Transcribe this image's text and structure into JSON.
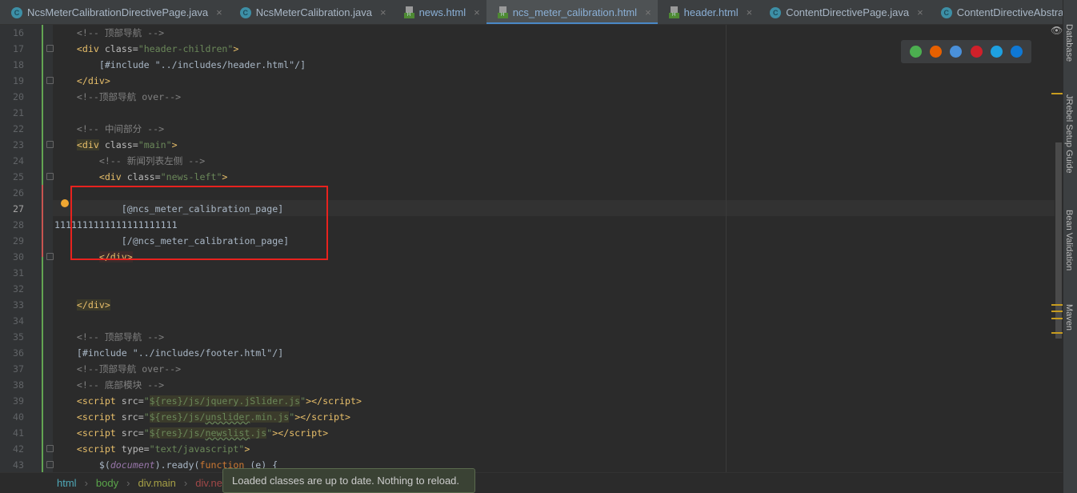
{
  "tabs": [
    {
      "label": "NcsMeterCalibrationDirectivePage.java",
      "type": "java",
      "active": false
    },
    {
      "label": "NcsMeterCalibration.java",
      "type": "java",
      "active": false
    },
    {
      "label": "news.html",
      "type": "html",
      "active": false
    },
    {
      "label": "ncs_meter_calibration.html",
      "type": "html",
      "active": true
    },
    {
      "label": "header.html",
      "type": "html",
      "active": false
    },
    {
      "label": "ContentDirectivePage.java",
      "type": "java",
      "active": false
    },
    {
      "label": "ContentDirectiveAbstract.java",
      "type": "java",
      "active": false
    }
  ],
  "editor": {
    "current_line": 27,
    "lines": [
      {
        "n": 16,
        "tokens": [
          [
            "    ",
            ""
          ],
          [
            "<!-- 顶部导航 -->",
            "c"
          ]
        ]
      },
      {
        "n": 17,
        "tokens": [
          [
            "    ",
            ""
          ],
          [
            "<div ",
            "t"
          ],
          [
            "class=",
            "a"
          ],
          [
            "\"header-children\"",
            "s"
          ],
          [
            ">",
            "t"
          ]
        ]
      },
      {
        "n": 18,
        "tokens": [
          [
            "        ",
            ""
          ],
          [
            "[#include \"../includes/header.html\"/]",
            "p"
          ]
        ]
      },
      {
        "n": 19,
        "tokens": [
          [
            "    ",
            ""
          ],
          [
            "</div>",
            "t"
          ]
        ]
      },
      {
        "n": 20,
        "tokens": [
          [
            "    ",
            ""
          ],
          [
            "<!--顶部导航 over-->",
            "c"
          ]
        ]
      },
      {
        "n": 21,
        "tokens": []
      },
      {
        "n": 22,
        "tokens": [
          [
            "    ",
            ""
          ],
          [
            "<!-- 中间部分 -->",
            "c"
          ]
        ]
      },
      {
        "n": 23,
        "tokens": [
          [
            "    ",
            ""
          ],
          [
            "<div",
            "t tb"
          ],
          [
            " class=",
            "a"
          ],
          [
            "\"main\"",
            "s"
          ],
          [
            ">",
            "t"
          ]
        ]
      },
      {
        "n": 24,
        "tokens": [
          [
            "        ",
            ""
          ],
          [
            "<!-- 新闻列表左侧 -->",
            "c"
          ]
        ]
      },
      {
        "n": 25,
        "tokens": [
          [
            "        ",
            ""
          ],
          [
            "<div ",
            "t"
          ],
          [
            "class=",
            "a"
          ],
          [
            "\"news-left\"",
            "s"
          ],
          [
            ">",
            "t"
          ]
        ]
      },
      {
        "n": 26,
        "tokens": []
      },
      {
        "n": 27,
        "tokens": [
          [
            "            ",
            ""
          ],
          [
            "[@ncs_meter_calibration_page]",
            "p"
          ]
        ]
      },
      {
        "n": 28,
        "tokens": [
          [
            "1111111111111111111111",
            "p"
          ]
        ]
      },
      {
        "n": 29,
        "tokens": [
          [
            "            ",
            ""
          ],
          [
            "[/@ncs_meter_calibration_page]",
            "p"
          ]
        ]
      },
      {
        "n": 30,
        "tokens": [
          [
            "        ",
            ""
          ],
          [
            "</div>",
            "t tm"
          ]
        ]
      },
      {
        "n": 31,
        "tokens": []
      },
      {
        "n": 32,
        "tokens": []
      },
      {
        "n": 33,
        "tokens": [
          [
            "    ",
            ""
          ],
          [
            "</div>",
            "t tb"
          ]
        ]
      },
      {
        "n": 34,
        "tokens": []
      },
      {
        "n": 35,
        "tokens": [
          [
            "    ",
            ""
          ],
          [
            "<!-- 顶部导航 -->",
            "c"
          ]
        ]
      },
      {
        "n": 36,
        "tokens": [
          [
            "    ",
            ""
          ],
          [
            "[#include \"../includes/footer.html\"/]",
            "p"
          ]
        ]
      },
      {
        "n": 37,
        "tokens": [
          [
            "    ",
            ""
          ],
          [
            "<!--顶部导航 over-->",
            "c"
          ]
        ]
      },
      {
        "n": 38,
        "tokens": [
          [
            "    ",
            ""
          ],
          [
            "<!-- 底部模块 -->",
            "c"
          ]
        ]
      },
      {
        "n": 39,
        "tokens": [
          [
            "    ",
            ""
          ],
          [
            "<script ",
            "t"
          ],
          [
            "src=",
            "a"
          ],
          [
            "\"",
            "s"
          ],
          [
            "${res}/js/jquery.jSlider.js",
            "h"
          ],
          [
            "\"",
            "s"
          ],
          [
            "></script>",
            "t"
          ]
        ]
      },
      {
        "n": 40,
        "tokens": [
          [
            "    ",
            ""
          ],
          [
            "<script ",
            "t"
          ],
          [
            "src=",
            "a"
          ],
          [
            "\"",
            "s"
          ],
          [
            "${res}/js/",
            "h"
          ],
          [
            "unslider",
            "h u"
          ],
          [
            ".min.js",
            "h"
          ],
          [
            "\"",
            "s"
          ],
          [
            "></script>",
            "t"
          ]
        ]
      },
      {
        "n": 41,
        "tokens": [
          [
            "    ",
            ""
          ],
          [
            "<script ",
            "t"
          ],
          [
            "src=",
            "a"
          ],
          [
            "\"",
            "s"
          ],
          [
            "${res}/js/",
            "h"
          ],
          [
            "newslist",
            "h u"
          ],
          [
            ".js",
            "h"
          ],
          [
            "\"",
            "s"
          ],
          [
            "></script>",
            "t"
          ]
        ]
      },
      {
        "n": 42,
        "tokens": [
          [
            "    ",
            ""
          ],
          [
            "<script ",
            "t"
          ],
          [
            "type=",
            "a"
          ],
          [
            "\"text/javascript\"",
            "s"
          ],
          [
            ">",
            "t"
          ]
        ]
      },
      {
        "n": 43,
        "tokens": [
          [
            "        ",
            ""
          ],
          [
            "$(",
            "p"
          ],
          [
            "document",
            "v"
          ],
          [
            ").ready(",
            "p"
          ],
          [
            "function ",
            "k"
          ],
          [
            "(e) {",
            "p"
          ]
        ]
      }
    ]
  },
  "browsers": [
    {
      "name": "chrome-icon",
      "color": "#4caf50"
    },
    {
      "name": "firefox-icon",
      "color": "#e66000"
    },
    {
      "name": "safari-icon",
      "color": "#4a90d9"
    },
    {
      "name": "opera-icon",
      "color": "#d0202a"
    },
    {
      "name": "ie-icon",
      "color": "#1ea0e0"
    },
    {
      "name": "edge-icon",
      "color": "#0f78d4"
    }
  ],
  "right_panel": [
    "Database",
    "JRebel Setup Guide",
    "Bean Validation",
    "Maven"
  ],
  "breadcrumb": [
    {
      "label": "html",
      "color": "#4fa8b8"
    },
    {
      "label": "body",
      "color": "#5aa54a"
    },
    {
      "label": "div.main",
      "color": "#a6a046"
    },
    {
      "label": "div.ne",
      "color": "#a04848"
    }
  ],
  "notification": "Loaded classes are up to date. Nothing to reload."
}
